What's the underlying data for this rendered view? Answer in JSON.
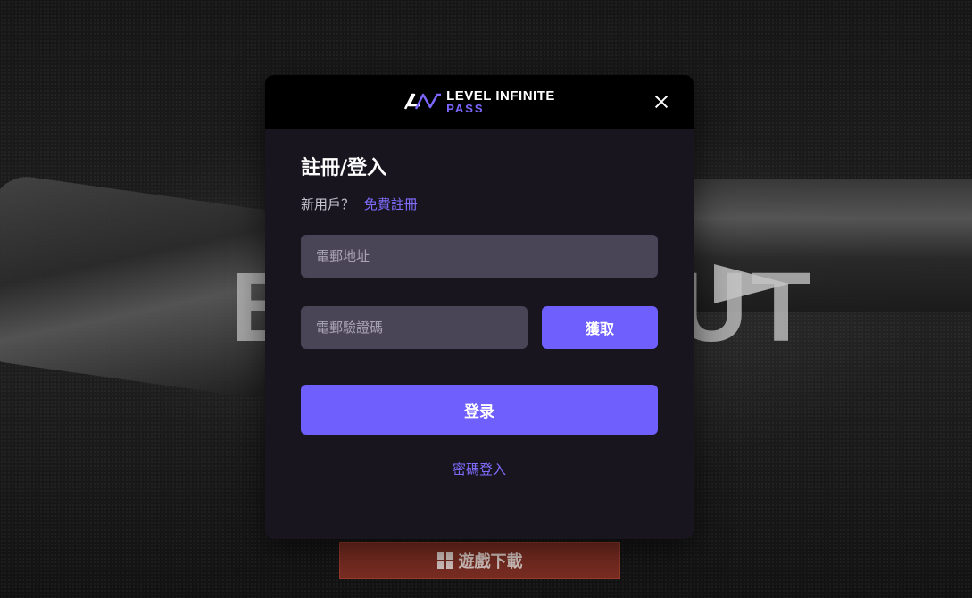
{
  "brand": {
    "line1": "LEVEL INFINITE",
    "line2": "PASS",
    "accent": "#6f5ffc"
  },
  "background": {
    "word_left": "B",
    "word_right": "UT"
  },
  "modal": {
    "title": "註冊/登入",
    "new_user_prompt": "新用戶？",
    "signup_link": "免費註冊",
    "email_placeholder": "電郵地址",
    "code_placeholder": "電郵驗證碼",
    "get_code_label": "獲取",
    "login_label": "登录",
    "password_login_label": "密碼登入",
    "close_icon": "close-icon"
  },
  "download": {
    "label": "遊戲下載",
    "icon": "windows-icon",
    "color": "#7a2d22"
  }
}
